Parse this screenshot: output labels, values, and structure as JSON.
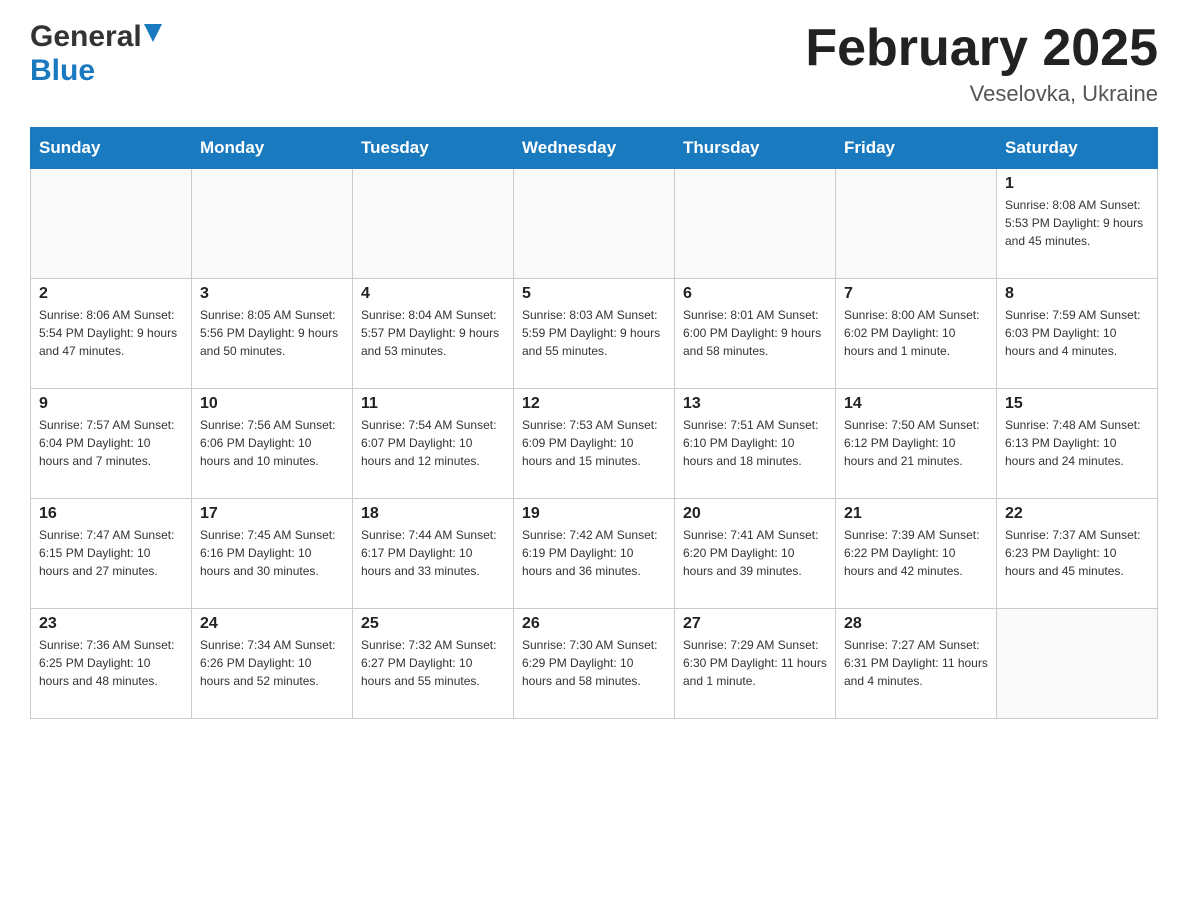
{
  "header": {
    "logo_general": "General",
    "logo_blue": "Blue",
    "month_title": "February 2025",
    "location": "Veselovka, Ukraine"
  },
  "days_of_week": [
    "Sunday",
    "Monday",
    "Tuesday",
    "Wednesday",
    "Thursday",
    "Friday",
    "Saturday"
  ],
  "weeks": [
    [
      {
        "day": "",
        "info": ""
      },
      {
        "day": "",
        "info": ""
      },
      {
        "day": "",
        "info": ""
      },
      {
        "day": "",
        "info": ""
      },
      {
        "day": "",
        "info": ""
      },
      {
        "day": "",
        "info": ""
      },
      {
        "day": "1",
        "info": "Sunrise: 8:08 AM\nSunset: 5:53 PM\nDaylight: 9 hours and 45 minutes."
      }
    ],
    [
      {
        "day": "2",
        "info": "Sunrise: 8:06 AM\nSunset: 5:54 PM\nDaylight: 9 hours and 47 minutes."
      },
      {
        "day": "3",
        "info": "Sunrise: 8:05 AM\nSunset: 5:56 PM\nDaylight: 9 hours and 50 minutes."
      },
      {
        "day": "4",
        "info": "Sunrise: 8:04 AM\nSunset: 5:57 PM\nDaylight: 9 hours and 53 minutes."
      },
      {
        "day": "5",
        "info": "Sunrise: 8:03 AM\nSunset: 5:59 PM\nDaylight: 9 hours and 55 minutes."
      },
      {
        "day": "6",
        "info": "Sunrise: 8:01 AM\nSunset: 6:00 PM\nDaylight: 9 hours and 58 minutes."
      },
      {
        "day": "7",
        "info": "Sunrise: 8:00 AM\nSunset: 6:02 PM\nDaylight: 10 hours and 1 minute."
      },
      {
        "day": "8",
        "info": "Sunrise: 7:59 AM\nSunset: 6:03 PM\nDaylight: 10 hours and 4 minutes."
      }
    ],
    [
      {
        "day": "9",
        "info": "Sunrise: 7:57 AM\nSunset: 6:04 PM\nDaylight: 10 hours and 7 minutes."
      },
      {
        "day": "10",
        "info": "Sunrise: 7:56 AM\nSunset: 6:06 PM\nDaylight: 10 hours and 10 minutes."
      },
      {
        "day": "11",
        "info": "Sunrise: 7:54 AM\nSunset: 6:07 PM\nDaylight: 10 hours and 12 minutes."
      },
      {
        "day": "12",
        "info": "Sunrise: 7:53 AM\nSunset: 6:09 PM\nDaylight: 10 hours and 15 minutes."
      },
      {
        "day": "13",
        "info": "Sunrise: 7:51 AM\nSunset: 6:10 PM\nDaylight: 10 hours and 18 minutes."
      },
      {
        "day": "14",
        "info": "Sunrise: 7:50 AM\nSunset: 6:12 PM\nDaylight: 10 hours and 21 minutes."
      },
      {
        "day": "15",
        "info": "Sunrise: 7:48 AM\nSunset: 6:13 PM\nDaylight: 10 hours and 24 minutes."
      }
    ],
    [
      {
        "day": "16",
        "info": "Sunrise: 7:47 AM\nSunset: 6:15 PM\nDaylight: 10 hours and 27 minutes."
      },
      {
        "day": "17",
        "info": "Sunrise: 7:45 AM\nSunset: 6:16 PM\nDaylight: 10 hours and 30 minutes."
      },
      {
        "day": "18",
        "info": "Sunrise: 7:44 AM\nSunset: 6:17 PM\nDaylight: 10 hours and 33 minutes."
      },
      {
        "day": "19",
        "info": "Sunrise: 7:42 AM\nSunset: 6:19 PM\nDaylight: 10 hours and 36 minutes."
      },
      {
        "day": "20",
        "info": "Sunrise: 7:41 AM\nSunset: 6:20 PM\nDaylight: 10 hours and 39 minutes."
      },
      {
        "day": "21",
        "info": "Sunrise: 7:39 AM\nSunset: 6:22 PM\nDaylight: 10 hours and 42 minutes."
      },
      {
        "day": "22",
        "info": "Sunrise: 7:37 AM\nSunset: 6:23 PM\nDaylight: 10 hours and 45 minutes."
      }
    ],
    [
      {
        "day": "23",
        "info": "Sunrise: 7:36 AM\nSunset: 6:25 PM\nDaylight: 10 hours and 48 minutes."
      },
      {
        "day": "24",
        "info": "Sunrise: 7:34 AM\nSunset: 6:26 PM\nDaylight: 10 hours and 52 minutes."
      },
      {
        "day": "25",
        "info": "Sunrise: 7:32 AM\nSunset: 6:27 PM\nDaylight: 10 hours and 55 minutes."
      },
      {
        "day": "26",
        "info": "Sunrise: 7:30 AM\nSunset: 6:29 PM\nDaylight: 10 hours and 58 minutes."
      },
      {
        "day": "27",
        "info": "Sunrise: 7:29 AM\nSunset: 6:30 PM\nDaylight: 11 hours and 1 minute."
      },
      {
        "day": "28",
        "info": "Sunrise: 7:27 AM\nSunset: 6:31 PM\nDaylight: 11 hours and 4 minutes."
      },
      {
        "day": "",
        "info": ""
      }
    ]
  ]
}
